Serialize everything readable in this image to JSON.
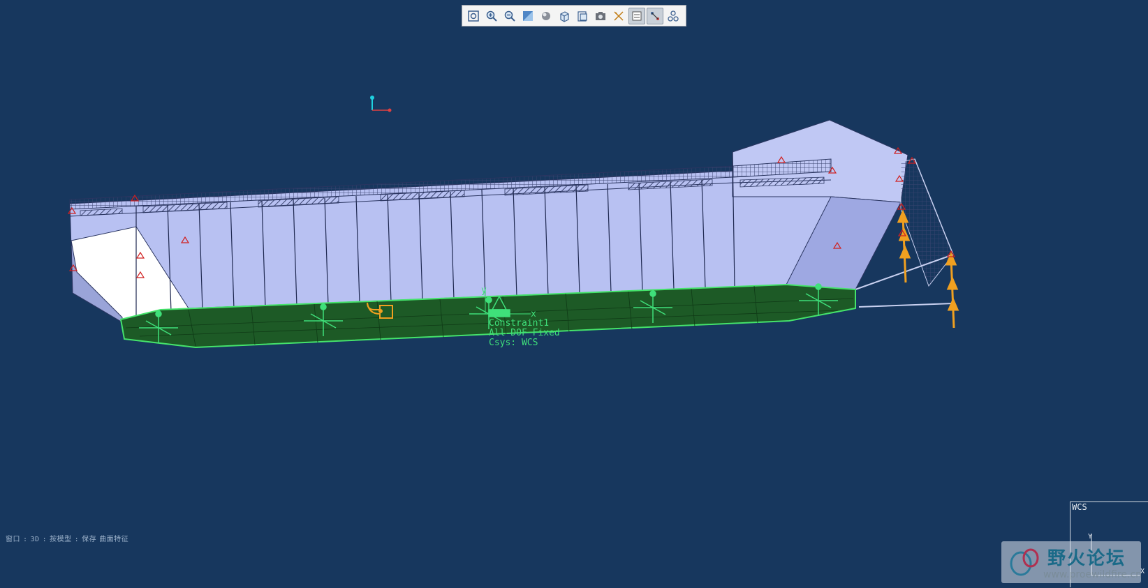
{
  "toolbar": {
    "buttons": [
      {
        "name": "refit-icon"
      },
      {
        "name": "zoom-in-icon"
      },
      {
        "name": "zoom-out-icon"
      },
      {
        "name": "repaint-icon"
      },
      {
        "name": "shading-icon"
      },
      {
        "name": "view-orientation-icon"
      },
      {
        "name": "saved-views-icon"
      },
      {
        "name": "snapshot-icon"
      },
      {
        "name": "datum-display-icon"
      },
      {
        "name": "annotation-display-icon",
        "active": true
      },
      {
        "name": "spin-center-icon",
        "active": true
      },
      {
        "name": "model-tree-display-icon"
      }
    ]
  },
  "constraint_label": {
    "line1": "Constraint1",
    "line2": "All DOF Fixed",
    "line3": "Csys: WCS"
  },
  "status_bar": {
    "items": [
      "窗口",
      ":",
      "3D",
      ":",
      "按模型",
      ":",
      "保存",
      "曲面特征"
    ]
  },
  "triad": {
    "x_axis": "X",
    "y_axis": "Y"
  },
  "wcs_panel": {
    "label": "WCS",
    "x_axis": "X",
    "y_axis": "Y"
  },
  "watermark": {
    "text": "野火论坛",
    "url": "www.proewildfire.cn"
  },
  "colors": {
    "background": "#17375e",
    "hull_fill": "#b8c1f2",
    "constraint_surface": "#1d5a26",
    "constraint_edge": "#45e36b",
    "load_arrow": "#f0a020"
  }
}
